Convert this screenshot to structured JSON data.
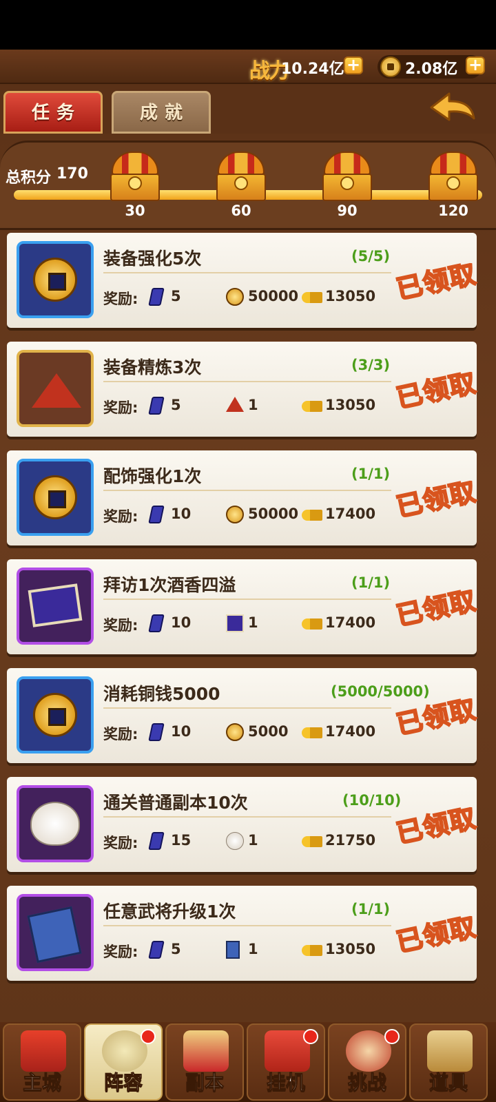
{
  "header": {
    "power_label": "战力",
    "power_value": "10.24亿",
    "coins_value": "2.08亿",
    "plus_symbol": "+"
  },
  "tabs": [
    {
      "label": "任务",
      "active": true
    },
    {
      "label": "成就",
      "active": false
    }
  ],
  "progress": {
    "score_label": "总积分",
    "score_value": "170",
    "max": 120,
    "milestones": [
      "30",
      "60",
      "90",
      "120"
    ]
  },
  "tasks": [
    {
      "title": "装备强化5次",
      "progress": "(5/5)",
      "reward_label": "奖励:",
      "icon": "coin-icon",
      "rewards": [
        {
          "icon": "ticket-icon",
          "value": "5"
        },
        {
          "icon": "coin-icon",
          "value": "50000"
        },
        {
          "icon": "key-icon",
          "value": "13050"
        }
      ],
      "status": "已领取"
    },
    {
      "title": "装备精炼3次",
      "progress": "(3/3)",
      "reward_label": "奖励:",
      "icon": "refine-powder-icon",
      "rewards": [
        {
          "icon": "ticket-icon",
          "value": "5"
        },
        {
          "icon": "refine-powder-icon",
          "value": "1"
        },
        {
          "icon": "key-icon",
          "value": "13050"
        }
      ],
      "status": "已领取"
    },
    {
      "title": "配饰强化1次",
      "progress": "(1/1)",
      "reward_label": "奖励:",
      "icon": "coin-icon",
      "rewards": [
        {
          "icon": "ticket-icon",
          "value": "10"
        },
        {
          "icon": "coin-icon",
          "value": "50000"
        },
        {
          "icon": "key-icon",
          "value": "17400"
        }
      ],
      "status": "已领取"
    },
    {
      "title": "拜访1次酒香四溢",
      "progress": "(1/1)",
      "reward_label": "奖励:",
      "icon": "map-scroll-icon",
      "rewards": [
        {
          "icon": "ticket-icon",
          "value": "10"
        },
        {
          "icon": "map-scroll-icon",
          "value": "1"
        },
        {
          "icon": "key-icon",
          "value": "17400"
        }
      ],
      "status": "已领取"
    },
    {
      "title": "消耗铜钱5000",
      "progress": "(5000/5000)",
      "reward_label": "奖励:",
      "icon": "coin-icon",
      "rewards": [
        {
          "icon": "ticket-icon",
          "value": "10"
        },
        {
          "icon": "coin-icon",
          "value": "5000"
        },
        {
          "icon": "key-icon",
          "value": "17400"
        }
      ],
      "status": "已领取"
    },
    {
      "title": "通关普通副本10次",
      "progress": "(10/10)",
      "reward_label": "奖励:",
      "icon": "steamed-bun-icon",
      "rewards": [
        {
          "icon": "ticket-icon",
          "value": "15"
        },
        {
          "icon": "steamed-bun-icon",
          "value": "1"
        },
        {
          "icon": "key-icon",
          "value": "21750"
        }
      ],
      "status": "已领取"
    },
    {
      "title": "任意武将升级1次",
      "progress": "(1/1)",
      "reward_label": "奖励:",
      "icon": "exp-book-icon",
      "rewards": [
        {
          "icon": "ticket-icon",
          "value": "5"
        },
        {
          "icon": "exp-book-icon",
          "value": "1"
        },
        {
          "icon": "key-icon",
          "value": "13050"
        }
      ],
      "status": "已领取"
    }
  ],
  "nav": [
    {
      "label": "主城",
      "active": false,
      "badge": false
    },
    {
      "label": "阵容",
      "active": true,
      "badge": true
    },
    {
      "label": "副本",
      "active": false,
      "badge": false
    },
    {
      "label": "挂机",
      "active": false,
      "badge": true
    },
    {
      "label": "挑战",
      "active": false,
      "badge": true
    },
    {
      "label": "道具",
      "active": false,
      "badge": false
    }
  ],
  "colors": {
    "progress_text": "#4c9e1a",
    "tab_active": "#c8281b",
    "stamp": "#d8541e"
  }
}
